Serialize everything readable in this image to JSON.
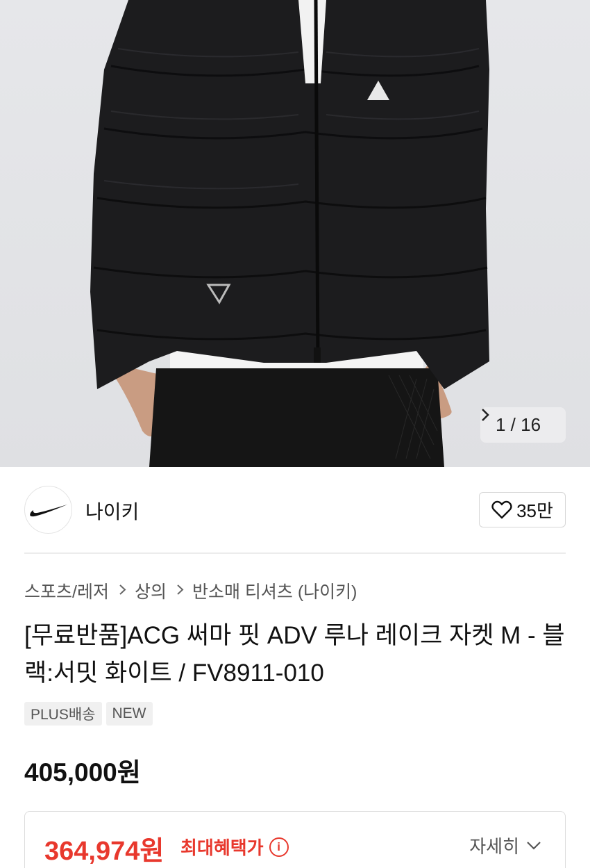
{
  "gallery": {
    "current": "1",
    "separator": "/",
    "total": "16",
    "next_icon": "chevron-right-icon"
  },
  "brand": {
    "name": "나이키",
    "logo_icon": "nike-swoosh-icon",
    "like_count": "35만",
    "like_icon": "heart-outline-icon"
  },
  "breadcrumb": {
    "items": [
      "스포츠/레저",
      "상의",
      "반소매 티셔츠 (나이키)"
    ],
    "separator_icon": "chevron-right-icon"
  },
  "product": {
    "title": "[무료반품]ACG 써마 핏 ADV 루나 레이크 자켓 M - 블랙:서밋 화이트 / FV8911-010",
    "tags": [
      "PLUS배송",
      "NEW"
    ],
    "price": "405,000원"
  },
  "benefit": {
    "price": "364,974원",
    "label": "최대혜택가",
    "info_icon": "info-circle-icon",
    "detail_label": "자세히",
    "detail_icon": "chevron-down-icon"
  },
  "colors": {
    "accent_red": "#e8382d",
    "background": "#ffffff",
    "hero_background": "#e3e4e7"
  }
}
